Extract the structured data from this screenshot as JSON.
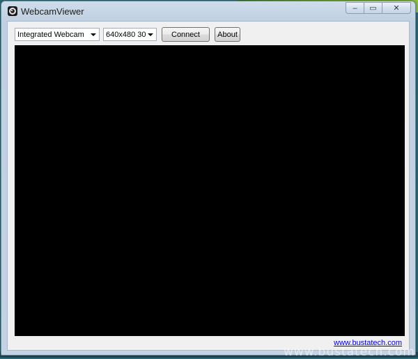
{
  "window": {
    "title": "WebcamViewer",
    "caption": {
      "minimize": "–",
      "maximize": "▭",
      "close": "✕"
    }
  },
  "toolbar": {
    "camera_select": {
      "value": "Integrated Webcam"
    },
    "format_select": {
      "value": "640x480 30"
    },
    "connect_label": "Connect",
    "about_label": "About"
  },
  "footer": {
    "link_text": "www.bustatech.com"
  },
  "watermark": "www.bustatech.com",
  "colors": {
    "video_background": "#000000",
    "link": "#0000ee",
    "window_frame": "#bfd0e2"
  },
  "icons": {
    "app": "webcam-icon",
    "dropdown": "chevron-down-icon"
  }
}
